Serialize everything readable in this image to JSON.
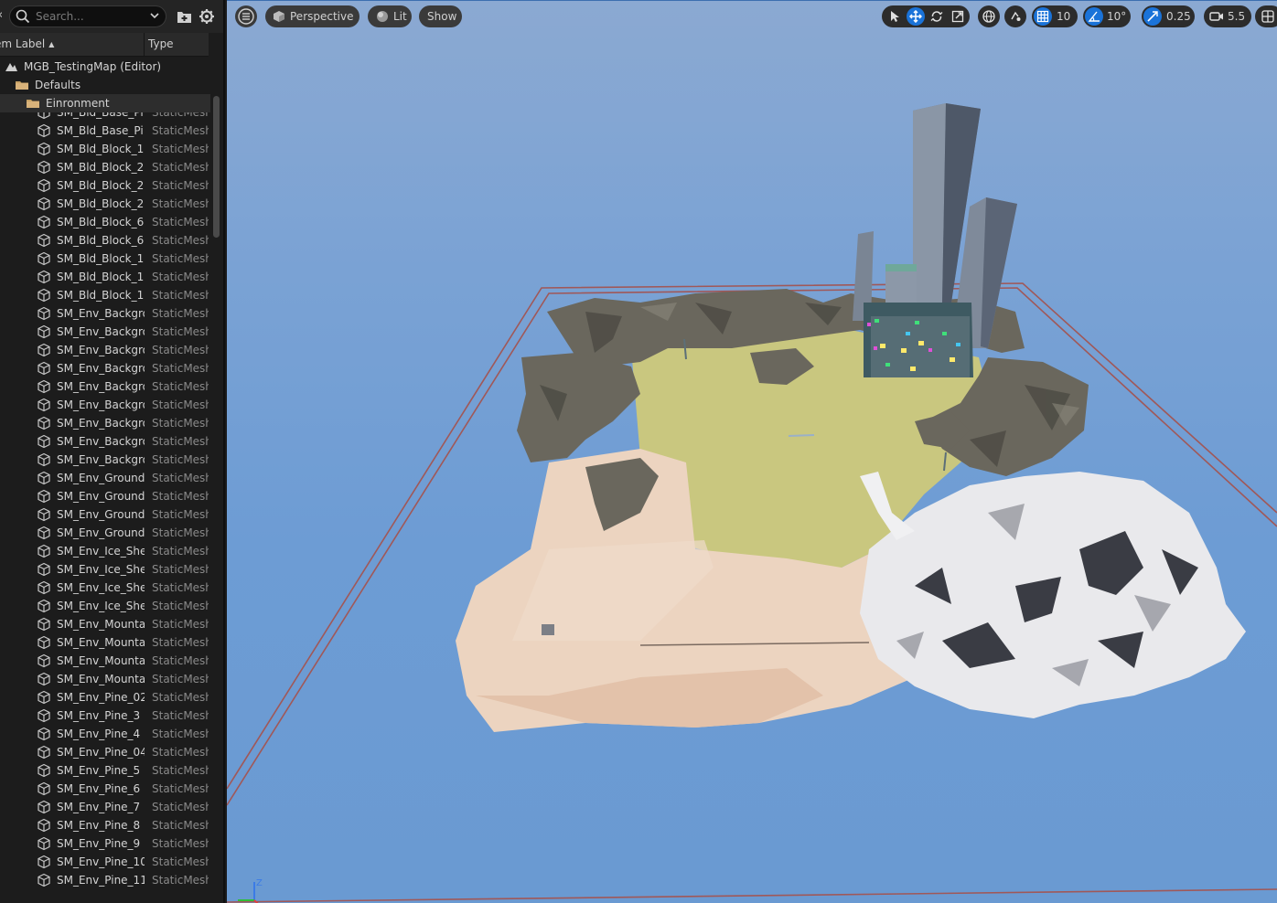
{
  "outliner": {
    "search_placeholder": "Search...",
    "col_label": "em Label",
    "col_type": "Type",
    "tree": [
      {
        "label": "MGB_TestingMap (Editor)",
        "type": "",
        "icon": "level-icon",
        "indent": 0
      },
      {
        "label": "Defaults",
        "type": "",
        "icon": "folder-icon",
        "indent": 1
      },
      {
        "label": "Einronment",
        "type": "",
        "icon": "folder-icon",
        "indent": 2
      },
      {
        "label": "SM_Bld_Base_Pi",
        "type": "StaticMesh",
        "icon": "static-mesh-icon",
        "indent": 3
      },
      {
        "label": "SM_Bld_Base_Pi",
        "type": "StaticMesh",
        "icon": "static-mesh-icon",
        "indent": 3
      },
      {
        "label": "SM_Bld_Block_1",
        "type": "StaticMesh",
        "icon": "static-mesh-icon",
        "indent": 3
      },
      {
        "label": "SM_Bld_Block_2",
        "type": "StaticMesh",
        "icon": "static-mesh-icon",
        "indent": 3
      },
      {
        "label": "SM_Bld_Block_2",
        "type": "StaticMesh",
        "icon": "static-mesh-icon",
        "indent": 3
      },
      {
        "label": "SM_Bld_Block_2",
        "type": "StaticMesh",
        "icon": "static-mesh-icon",
        "indent": 3
      },
      {
        "label": "SM_Bld_Block_6",
        "type": "StaticMesh",
        "icon": "static-mesh-icon",
        "indent": 3
      },
      {
        "label": "SM_Bld_Block_6",
        "type": "StaticMesh",
        "icon": "static-mesh-icon",
        "indent": 3
      },
      {
        "label": "SM_Bld_Block_1",
        "type": "StaticMesh",
        "icon": "static-mesh-icon",
        "indent": 3
      },
      {
        "label": "SM_Bld_Block_1",
        "type": "StaticMesh",
        "icon": "static-mesh-icon",
        "indent": 3
      },
      {
        "label": "SM_Bld_Block_1",
        "type": "StaticMesh",
        "icon": "static-mesh-icon",
        "indent": 3
      },
      {
        "label": "SM_Env_Backgro",
        "type": "StaticMesh",
        "icon": "static-mesh-icon",
        "indent": 3
      },
      {
        "label": "SM_Env_Backgro",
        "type": "StaticMesh",
        "icon": "static-mesh-icon",
        "indent": 3
      },
      {
        "label": "SM_Env_Backgro",
        "type": "StaticMesh",
        "icon": "static-mesh-icon",
        "indent": 3
      },
      {
        "label": "SM_Env_Backgro",
        "type": "StaticMesh",
        "icon": "static-mesh-icon",
        "indent": 3
      },
      {
        "label": "SM_Env_Backgro",
        "type": "StaticMesh",
        "icon": "static-mesh-icon",
        "indent": 3
      },
      {
        "label": "SM_Env_Backgro",
        "type": "StaticMesh",
        "icon": "static-mesh-icon",
        "indent": 3
      },
      {
        "label": "SM_Env_Backgro",
        "type": "StaticMesh",
        "icon": "static-mesh-icon",
        "indent": 3
      },
      {
        "label": "SM_Env_Backgro",
        "type": "StaticMesh",
        "icon": "static-mesh-icon",
        "indent": 3
      },
      {
        "label": "SM_Env_Backgro",
        "type": "StaticMesh",
        "icon": "static-mesh-icon",
        "indent": 3
      },
      {
        "label": "SM_Env_Ground_",
        "type": "StaticMesh",
        "icon": "static-mesh-icon",
        "indent": 3
      },
      {
        "label": "SM_Env_Ground_",
        "type": "StaticMesh",
        "icon": "static-mesh-icon",
        "indent": 3
      },
      {
        "label": "SM_Env_Ground_",
        "type": "StaticMesh",
        "icon": "static-mesh-icon",
        "indent": 3
      },
      {
        "label": "SM_Env_Ground_",
        "type": "StaticMesh",
        "icon": "static-mesh-icon",
        "indent": 3
      },
      {
        "label": "SM_Env_Ice_She",
        "type": "StaticMesh",
        "icon": "static-mesh-icon",
        "indent": 3
      },
      {
        "label": "SM_Env_Ice_She",
        "type": "StaticMesh",
        "icon": "static-mesh-icon",
        "indent": 3
      },
      {
        "label": "SM_Env_Ice_She",
        "type": "StaticMesh",
        "icon": "static-mesh-icon",
        "indent": 3
      },
      {
        "label": "SM_Env_Ice_She",
        "type": "StaticMesh",
        "icon": "static-mesh-icon",
        "indent": 3
      },
      {
        "label": "SM_Env_Mounta",
        "type": "StaticMesh",
        "icon": "static-mesh-icon",
        "indent": 3
      },
      {
        "label": "SM_Env_Mounta",
        "type": "StaticMesh",
        "icon": "static-mesh-icon",
        "indent": 3
      },
      {
        "label": "SM_Env_Mounta",
        "type": "StaticMesh",
        "icon": "static-mesh-icon",
        "indent": 3
      },
      {
        "label": "SM_Env_Mounta",
        "type": "StaticMesh",
        "icon": "static-mesh-icon",
        "indent": 3
      },
      {
        "label": "SM_Env_Pine_02",
        "type": "StaticMesh",
        "icon": "static-mesh-icon",
        "indent": 3
      },
      {
        "label": "SM_Env_Pine_3",
        "type": "StaticMesh",
        "icon": "static-mesh-icon",
        "indent": 3
      },
      {
        "label": "SM_Env_Pine_4",
        "type": "StaticMesh",
        "icon": "static-mesh-icon",
        "indent": 3
      },
      {
        "label": "SM_Env_Pine_04",
        "type": "StaticMesh",
        "icon": "static-mesh-icon",
        "indent": 3
      },
      {
        "label": "SM_Env_Pine_5",
        "type": "StaticMesh",
        "icon": "static-mesh-icon",
        "indent": 3
      },
      {
        "label": "SM_Env_Pine_6",
        "type": "StaticMesh",
        "icon": "static-mesh-icon",
        "indent": 3
      },
      {
        "label": "SM_Env_Pine_7",
        "type": "StaticMesh",
        "icon": "static-mesh-icon",
        "indent": 3
      },
      {
        "label": "SM_Env_Pine_8",
        "type": "StaticMesh",
        "icon": "static-mesh-icon",
        "indent": 3
      },
      {
        "label": "SM_Env_Pine_9",
        "type": "StaticMesh",
        "icon": "static-mesh-icon",
        "indent": 3
      },
      {
        "label": "SM_Env_Pine_10",
        "type": "StaticMesh",
        "icon": "static-mesh-icon",
        "indent": 3
      },
      {
        "label": "SM_Env_Pine_11",
        "type": "StaticMesh",
        "icon": "static-mesh-icon",
        "indent": 3
      }
    ]
  },
  "viewport": {
    "view_mode": "Perspective",
    "lighting": "Lit",
    "show": "Show",
    "grid_snap": "10",
    "rotation_snap": "10°",
    "scale_snap": "0.25",
    "camera_speed": "5.5",
    "axis_label": "Z"
  },
  "colors": {
    "accent": "#1a73d9",
    "sky": "#6d9cd4",
    "grass": "#c9c77f",
    "sand": "#ecd4c0",
    "rock": "#6a675d",
    "snow": "#e9e9ec"
  }
}
